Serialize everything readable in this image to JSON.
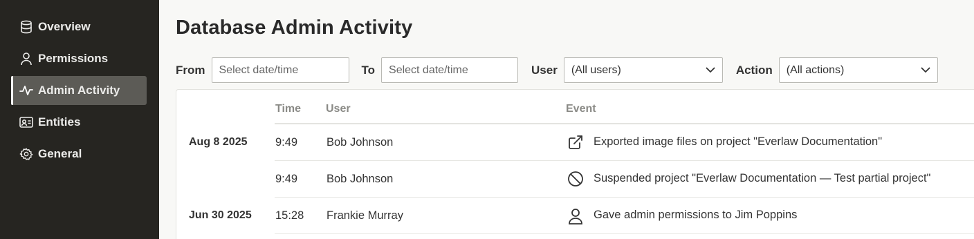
{
  "sidebar": {
    "items": [
      {
        "label": "Overview",
        "icon": "database-icon",
        "active": false
      },
      {
        "label": "Permissions",
        "icon": "user-icon",
        "active": false
      },
      {
        "label": "Admin Activity",
        "icon": "activity-icon",
        "active": true
      },
      {
        "label": "Entities",
        "icon": "id-card-icon",
        "active": false
      },
      {
        "label": "General",
        "icon": "gear-icon",
        "active": false
      }
    ]
  },
  "main": {
    "title": "Database Admin Activity",
    "filters": {
      "from_label": "From",
      "from_placeholder": "Select date/time",
      "to_label": "To",
      "to_placeholder": "Select date/time",
      "user_label": "User",
      "user_value": "(All users)",
      "action_label": "Action",
      "action_value": "(All actions)"
    },
    "table": {
      "columns": [
        "Time",
        "User",
        "Event"
      ],
      "rows": [
        {
          "date": "Aug 8 2025",
          "time": "9:49",
          "user": "Bob Johnson",
          "event_icon": "external-link-icon",
          "event": "Exported image files on project \"Everlaw Documentation\""
        },
        {
          "date": "",
          "time": "9:49",
          "user": "Bob Johnson",
          "event_icon": "ban-icon",
          "event": "Suspended project \"Everlaw Documentation — Test partial project\""
        },
        {
          "date": "Jun 30 2025",
          "time": "15:28",
          "user": "Frankie Murray",
          "event_icon": "user-icon",
          "event": "Gave admin permissions to Jim Poppins"
        }
      ]
    }
  }
}
